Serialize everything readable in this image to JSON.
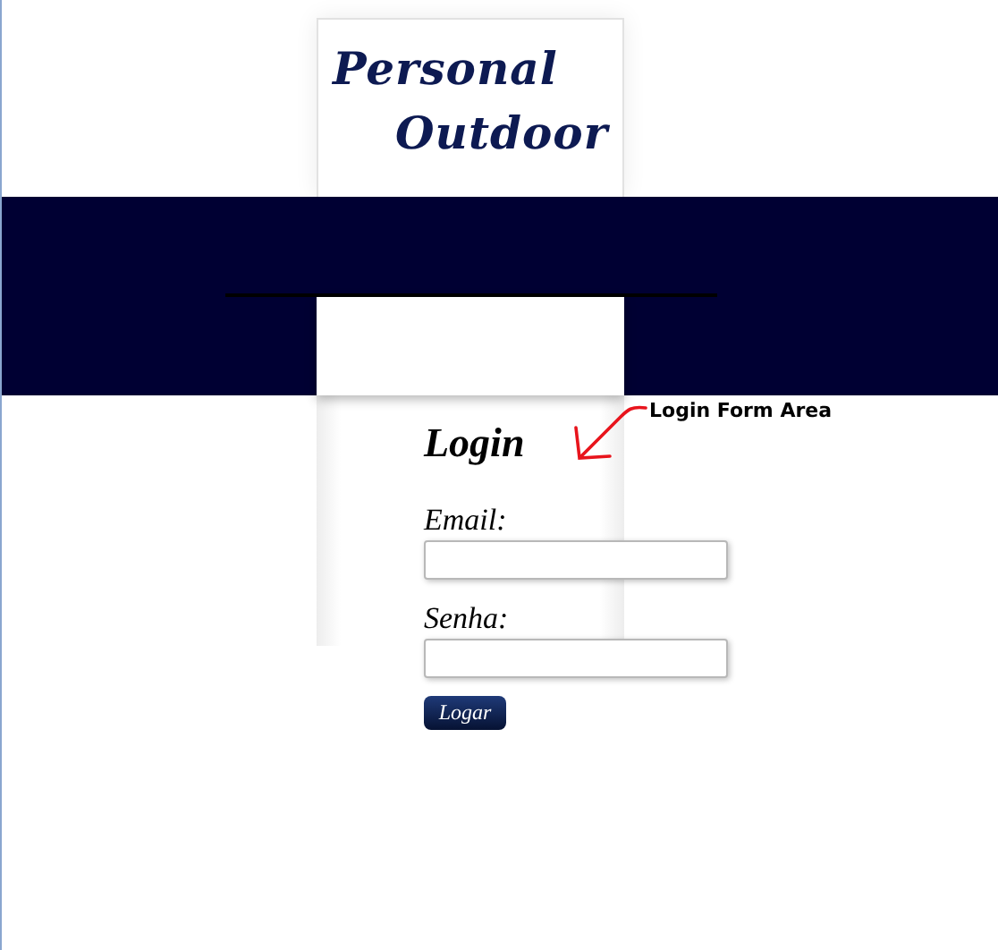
{
  "logo": {
    "lines": [
      "Personal",
      "Outdoor"
    ]
  },
  "login": {
    "title": "Login",
    "fields": [
      {
        "label": "Email:"
      },
      {
        "label": "Senha:"
      }
    ],
    "button": "Logar"
  },
  "annotation": {
    "text": "Login Form Area"
  }
}
